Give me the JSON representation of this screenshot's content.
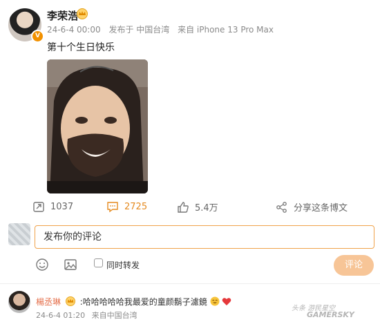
{
  "post": {
    "author": "李荣浩",
    "date": "24-6-4 00:00",
    "location": "发布于 中国台湾",
    "device": "来自 iPhone 13 Pro Max",
    "text": "第十个生日快乐"
  },
  "actions": {
    "repost_count": "1037",
    "comment_count": "2725",
    "like_count": "5.4万",
    "share_label": "分享这条博文"
  },
  "comment_box": {
    "placeholder": "发布你的评论",
    "repost_label": "同时转发",
    "send_label": "评论"
  },
  "reply": {
    "name": "楊丞琳",
    "text": ":哈哈哈哈哈我最爱的童颜鬍子濾鏡",
    "date": "24-6-4 01:20",
    "location": "来自中国台湾"
  },
  "watermark": {
    "line1": "头条 游民星空",
    "line2": "GAMERSKY"
  },
  "colors": {
    "accent": "#f29100",
    "input_border": "#f0a24a",
    "send_button": "#f7c597",
    "reply_name": "#e46c47",
    "comment_count": "#e58a1f"
  }
}
